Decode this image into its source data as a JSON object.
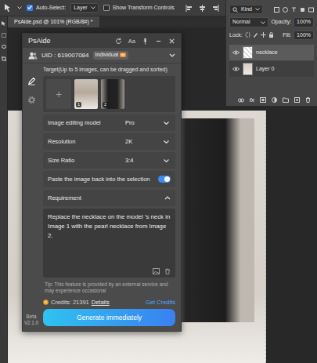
{
  "options_bar": {
    "auto_select": {
      "label": "Auto-Select:",
      "checked": true
    },
    "target": "Layer",
    "transform_controls": {
      "label": "Show Transform Controls",
      "checked": false
    }
  },
  "document_tab": {
    "title": "PsAide.psd @ 101% (RGB/8#) *",
    "selected": true
  },
  "layers_panel": {
    "filter": "Kind",
    "blend_mode": "Normal",
    "opacity_label": "Opacity:",
    "opacity": "100%",
    "lock_label": "Lock:",
    "fill_label": "Fill:",
    "fill": "100%",
    "layers": [
      {
        "name": "necklace",
        "visible": true,
        "selected": true
      },
      {
        "name": "Layer 0",
        "visible": true,
        "selected": false
      }
    ],
    "footer_fx": "fx"
  },
  "plugin": {
    "title": "PsAide",
    "font_button": "Aa",
    "uid": "UID : 619007084",
    "plan": "Individual",
    "tools": [
      {
        "kind": "edit",
        "selected": true
      },
      {
        "kind": "settings",
        "selected": false
      }
    ],
    "version": [
      "Beta",
      "V2.1.0"
    ],
    "target_label": "Target(Up to 5 images, can be dragged and sorted)",
    "add_button": "+",
    "images": [
      {
        "number": "1"
      },
      {
        "number": "2"
      }
    ],
    "settings": [
      {
        "kind": "select",
        "label": "Image editing model",
        "value": "Pro"
      },
      {
        "kind": "select",
        "label": "Resolution",
        "value": "2K"
      },
      {
        "kind": "select",
        "label": "Size Ratio",
        "value": "3:4"
      },
      {
        "kind": "toggle",
        "label": "Paste the image back into the selection",
        "on": true
      }
    ],
    "requirement": {
      "label": "Requirement",
      "expanded": true,
      "text": "Replace the necklace on the model 's neck in Image 1 with the pearl necklace from Image 2."
    },
    "tip": "Tip: This feature is provided by an external service and may experience occasional",
    "credits": {
      "label": "Credits: 21391",
      "details": "Details",
      "get": "Get Credits"
    },
    "generate_button": "Generate immediately"
  }
}
